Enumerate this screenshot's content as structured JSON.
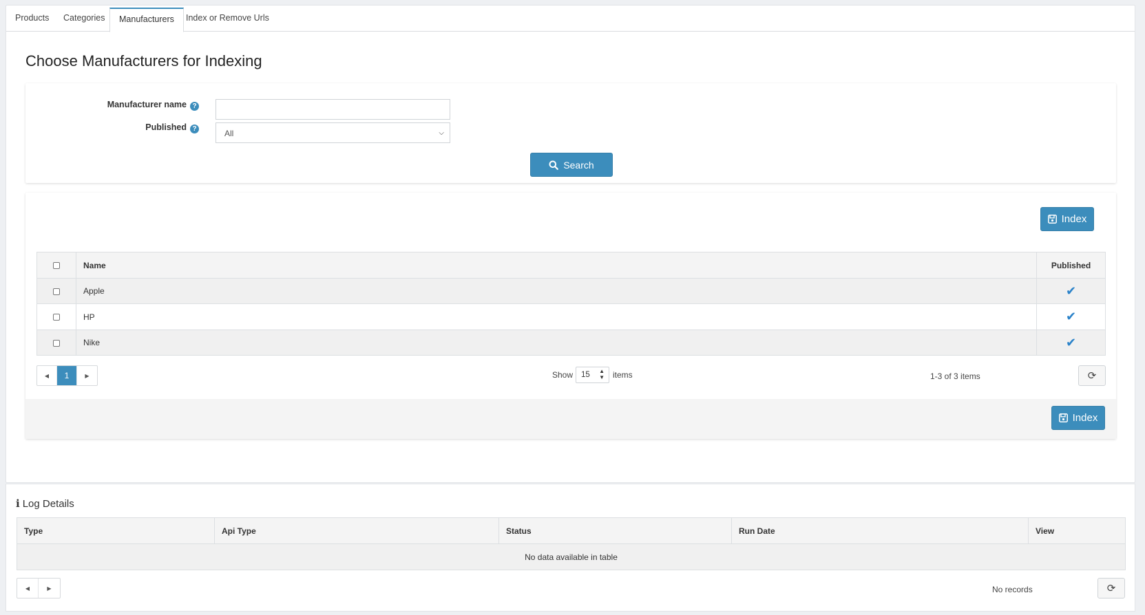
{
  "tabs": [
    {
      "label": "Products"
    },
    {
      "label": "Categories"
    },
    {
      "label": "Manufacturers",
      "active": true
    },
    {
      "label": "Index or Remove Urls"
    }
  ],
  "page_title": "Choose Manufacturers for Indexing",
  "search": {
    "manufacturer_name_label": "Manufacturer name",
    "manufacturer_name_value": "",
    "published_label": "Published",
    "published_value": "All",
    "search_button": "Search"
  },
  "grid": {
    "index_button": "Index",
    "columns": {
      "name": "Name",
      "published": "Published"
    },
    "rows": [
      {
        "name": "Apple",
        "published": true
      },
      {
        "name": "HP",
        "published": true
      },
      {
        "name": "Nike",
        "published": true
      }
    ],
    "pager": {
      "current_page": "1"
    },
    "show_label": "Show",
    "page_size": "15",
    "items_label": "items",
    "range_text": "1-3 of 3 items"
  },
  "log": {
    "title": "Log Details",
    "columns": {
      "type": "Type",
      "api_type": "Api Type",
      "status": "Status",
      "run_date": "Run Date",
      "view": "View"
    },
    "empty_text": "No data available in table",
    "records_text": "No records"
  },
  "colors": {
    "primary": "#3c8dbc",
    "check": "#2a82c9"
  },
  "icons": {
    "help": "question-circle-icon",
    "search": "search-icon",
    "save": "save-icon",
    "refresh": "refresh-icon",
    "info": "info-icon"
  }
}
